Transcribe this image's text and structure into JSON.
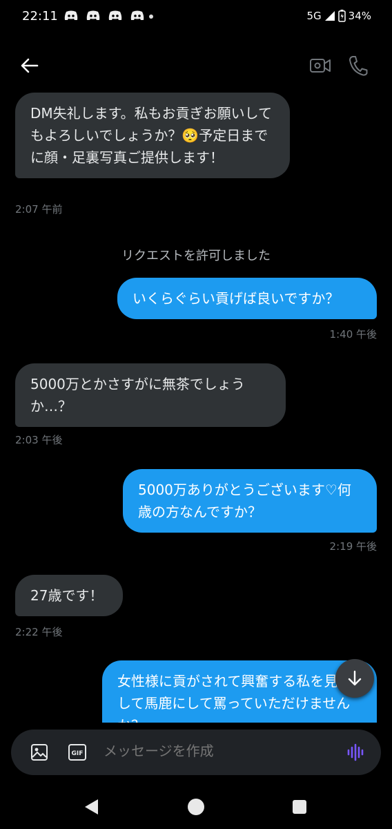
{
  "status": {
    "time": "22:11",
    "network": "5G",
    "battery": "34%"
  },
  "colors": {
    "background": "#000000",
    "incoming_bubble": "#2f3336",
    "outgoing_bubble": "#1d9bf0",
    "timestamp": "#71767b",
    "mic_accent": "#7856ff"
  },
  "icons": {
    "back": "arrow-left-icon",
    "video": "video-camera-icon",
    "phone": "phone-icon",
    "scroll": "arrow-down-icon",
    "image": "image-icon",
    "gif": "gif-icon",
    "voice": "voice-wave-icon"
  },
  "messages": [
    {
      "direction": "in",
      "text": "DM失礼します。私もお貢ぎお願いしてもよろしいでしょうか？🥺予定日までに顔・足裏写真ご提供します！",
      "time": "2:07 午前"
    },
    {
      "direction": "out",
      "text": "いくらぐらい貢げば良いですか？",
      "time": "1:40 午後"
    },
    {
      "direction": "in",
      "text": "5000万とかさすがに無茶でしょうか…？",
      "time": "2:03 午後"
    },
    {
      "direction": "out",
      "text": "5000万ありがとうございます♡何歳の方なんですか？",
      "time": "2:19 午後"
    },
    {
      "direction": "in",
      "text": "27歳です！",
      "time": "2:22 午後"
    },
    {
      "direction": "out",
      "text": "女性様に貢がされて興奮する私を見下して馬鹿にして罵っていただけませんか？",
      "time": ""
    }
  ],
  "system_message": "リクエストを許可しました",
  "composer": {
    "gif_label": "GIF",
    "placeholder": "メッセージを作成"
  }
}
